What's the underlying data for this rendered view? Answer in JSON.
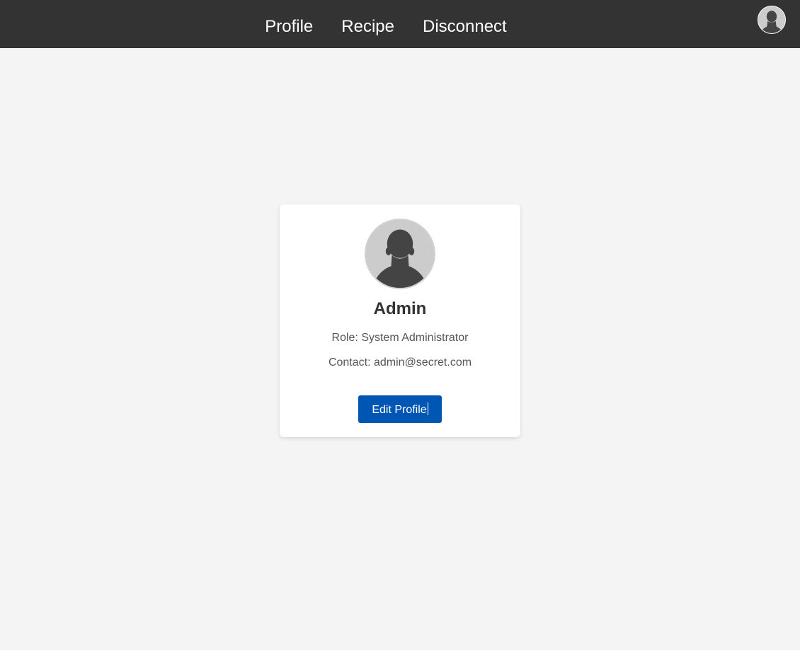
{
  "nav": {
    "links": [
      {
        "label": "Profile"
      },
      {
        "label": "Recipe"
      },
      {
        "label": "Disconnect"
      }
    ],
    "avatar_icon": "user-avatar-icon"
  },
  "profile": {
    "avatar_icon": "user-silhouette-icon",
    "name": "Admin",
    "role": "Role: System Administrator",
    "contact": "Contact: admin@secret.com",
    "edit_label": "Edit Profile"
  },
  "colors": {
    "navbar": "#333333",
    "background": "#f4f4f4",
    "button": "#0056b3",
    "silhouette": "#444444",
    "avatar_bg": "#cccccc"
  }
}
